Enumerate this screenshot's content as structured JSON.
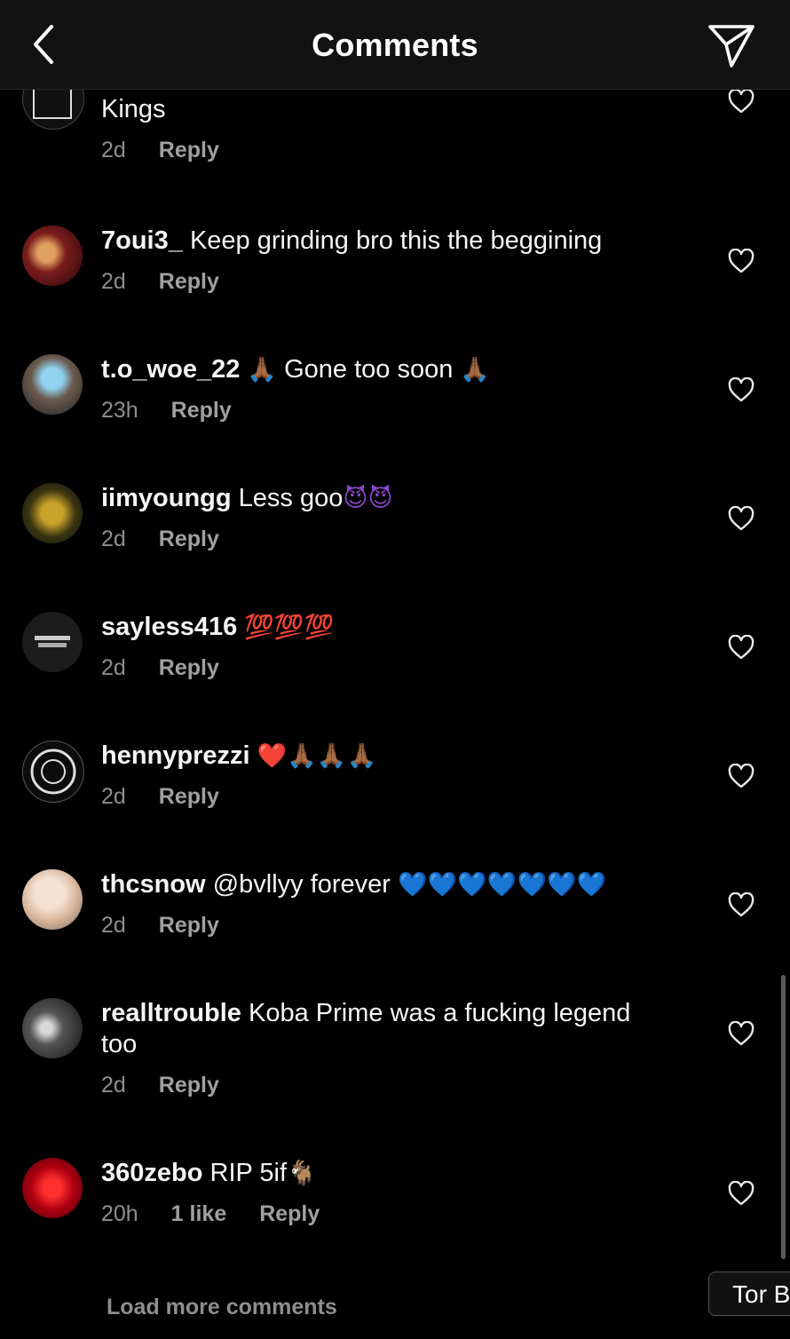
{
  "header": {
    "title": "Comments"
  },
  "icons": {
    "back": "chevron-left-icon",
    "send": "paper-plane-icon",
    "like": "heart-outline-icon"
  },
  "colors": {
    "background": "#000000",
    "header_bg": "#121212",
    "meta_text": "#8e8e8e"
  },
  "comments": [
    {
      "username": "",
      "text": "Kings",
      "time": "2d",
      "likes": "",
      "reply": "Reply"
    },
    {
      "username": "7oui3_",
      "text": "Keep grinding bro this the beggining",
      "time": "2d",
      "likes": "",
      "reply": "Reply"
    },
    {
      "username": "t.o_woe_22",
      "text": "Gone too soon",
      "emoji_before": "🙏🏾",
      "emoji_after": "🙏🏾",
      "time": "23h",
      "likes": "",
      "reply": "Reply"
    },
    {
      "username": "iimyoungg",
      "text": "Less goo",
      "emoji_after": "😈😈",
      "time": "2d",
      "likes": "",
      "reply": "Reply"
    },
    {
      "username": "sayless416",
      "text": "",
      "emoji_after": "💯💯💯",
      "time": "2d",
      "likes": "",
      "reply": "Reply"
    },
    {
      "username": "hennyprezzi",
      "text": "",
      "emoji_after": "❤️🙏🏾🙏🏾🙏🏾",
      "time": "2d",
      "likes": "",
      "reply": "Reply"
    },
    {
      "username": "thcsnow",
      "text": "@bvllyy forever",
      "emoji_after": "💙💙💙💙💙💙💙",
      "time": "2d",
      "likes": "",
      "reply": "Reply"
    },
    {
      "username": "realltrouble",
      "text": "Koba Prime was a fucking legend too",
      "time": "2d",
      "likes": "",
      "reply": "Reply"
    },
    {
      "username": "360zebo",
      "text": "RIP 5if",
      "emoji_after": "🐐",
      "time": "20h",
      "likes": "1 like",
      "reply": "Reply"
    }
  ],
  "load_more": "Load more comments",
  "overlay_pill": "Tor B"
}
